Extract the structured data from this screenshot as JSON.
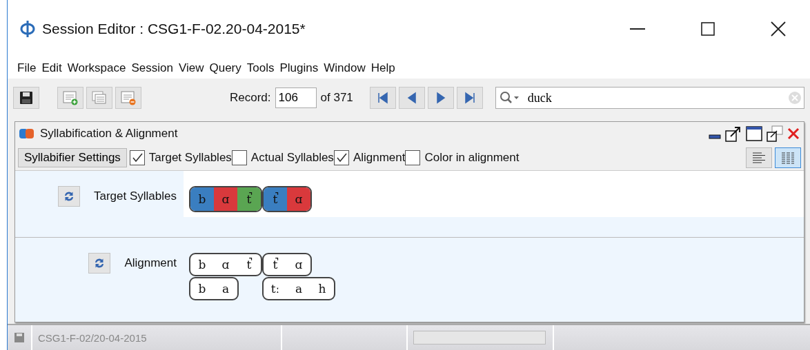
{
  "window": {
    "title": "Session Editor : CSG1-F-02.20-04-2015*"
  },
  "menu": [
    "File",
    "Edit",
    "Workspace",
    "Session",
    "View",
    "Query",
    "Tools",
    "Plugins",
    "Window",
    "Help"
  ],
  "toolbar": {
    "record_label": "Record:",
    "record": "106",
    "record_total": "of 371",
    "search": {
      "value": "duck"
    }
  },
  "panel": {
    "title": "Syllabification & Alignment",
    "settings_button": "Syllabifier Settings",
    "options": [
      {
        "label": "Target Syllables",
        "checked": true
      },
      {
        "label": "Actual Syllables",
        "checked": false
      },
      {
        "label": "Alignment",
        "checked": true
      },
      {
        "label": "Color in alignment",
        "checked": false
      }
    ],
    "view_buttons": [
      {
        "kind": "left-align",
        "selected": false
      },
      {
        "kind": "columns",
        "selected": true
      }
    ],
    "target_syllables": {
      "label": "Target Syllables",
      "syllables": [
        [
          {
            "text": "b",
            "color": "#3a7ec0"
          },
          {
            "text": "ɑ",
            "color": "#d9393c"
          },
          {
            "text": "t̚",
            "color": "#5aa552"
          }
        ],
        [
          {
            "text": "t̚",
            "color": "#3a7ec0"
          },
          {
            "text": "ɑ",
            "color": "#d9393c"
          }
        ]
      ]
    },
    "alignment": {
      "label": "Alignment",
      "columns": [
        {
          "target": [
            "b",
            "ɑ",
            "t̚"
          ],
          "actual": [
            "b",
            "a"
          ]
        },
        {
          "target": [
            "t̚",
            "ɑ"
          ],
          "actual": [
            "tː",
            "a",
            "h"
          ]
        }
      ]
    }
  },
  "status_bar": {
    "text": "CSG1-F-02/20-04-2015"
  }
}
